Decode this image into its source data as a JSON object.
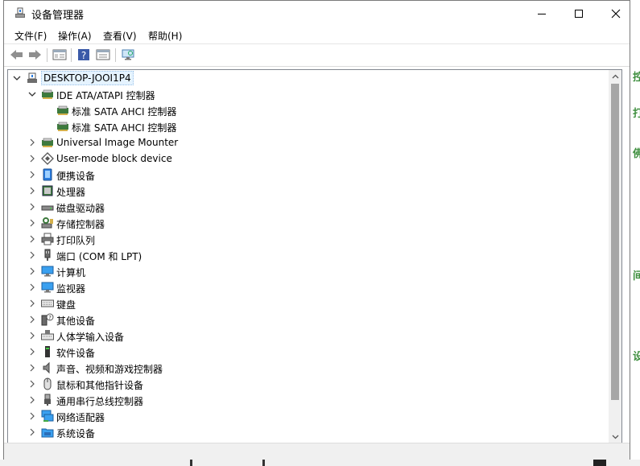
{
  "window": {
    "title": "设备管理器"
  },
  "menu": {
    "file": "文件(F)",
    "action": "操作(A)",
    "view": "查看(V)",
    "help": "帮助(H)"
  },
  "tree": {
    "root": "DESKTOP-JOOI1P4",
    "ide": "IDE ATA/ATAPI 控制器",
    "ide_child1": "标准 SATA AHCI 控制器",
    "ide_child2": "标准 SATA AHCI 控制器",
    "cat_image_mounter": "Universal Image Mounter",
    "cat_block_device": "User-mode block device",
    "cat_portable": "便携设备",
    "cat_processor": "处理器",
    "cat_disk": "磁盘驱动器",
    "cat_storage": "存储控制器",
    "cat_print_queue": "打印队列",
    "cat_ports": "端口 (COM 和 LPT)",
    "cat_computer": "计算机",
    "cat_monitor": "监视器",
    "cat_keyboard": "键盘",
    "cat_other": "其他设备",
    "cat_hid": "人体学输入设备",
    "cat_software": "软件设备",
    "cat_sound": "声音、视频和游戏控制器",
    "cat_mouse": "鼠标和其他指针设备",
    "cat_usb": "通用串行总线控制器",
    "cat_network": "网络适配器",
    "cat_system": "系统设备"
  },
  "background": {
    "right_glyphs": [
      "控",
      "打",
      "佛",
      "间",
      "设"
    ],
    "accent": "#3f8f3f"
  }
}
